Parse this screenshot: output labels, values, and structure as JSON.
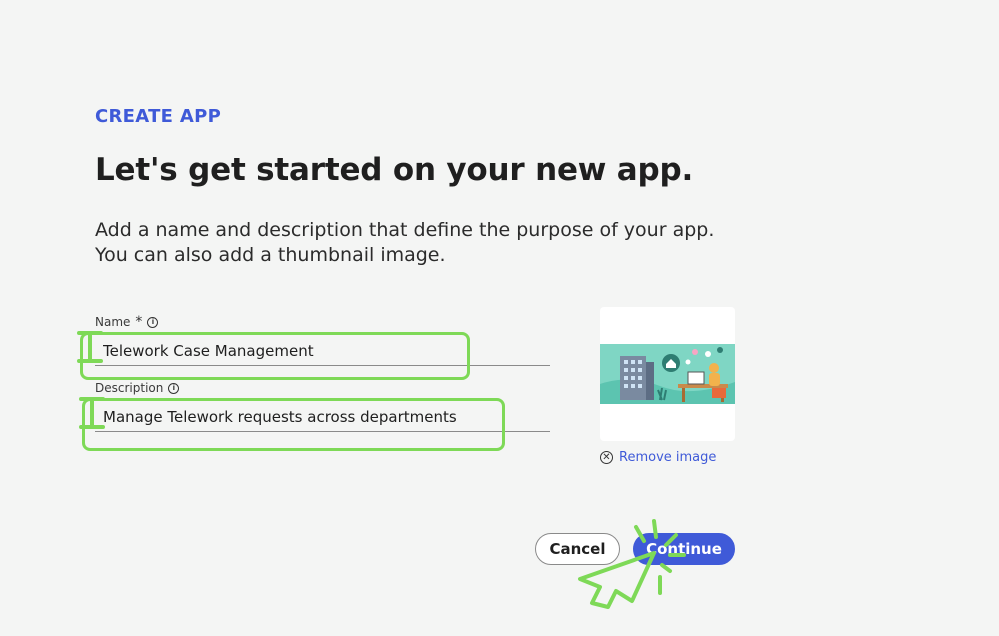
{
  "header": {
    "eyebrow": "CREATE APP",
    "title": "Let's get started on your new app.",
    "intro_line1": "Add a name and description that define the purpose of your app.",
    "intro_line2": "You can also add a thumbnail image."
  },
  "form": {
    "name": {
      "label": "Name",
      "required_marker": "*",
      "info_glyph": "i",
      "value": "Telework Case Management"
    },
    "description": {
      "label": "Description",
      "info_glyph": "i",
      "value": "Manage Telework requests across departments"
    }
  },
  "thumbnail": {
    "remove_label": "Remove image",
    "remove_icon": "close-circle-icon",
    "image_icon": "telework-illustration"
  },
  "actions": {
    "cancel_label": "Cancel",
    "continue_label": "Continue"
  },
  "colors": {
    "accent": "#3f5ad8",
    "annotation": "#7ed957",
    "background": "#f4f5f4"
  }
}
